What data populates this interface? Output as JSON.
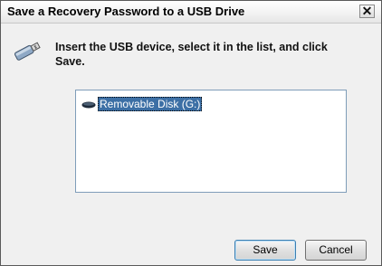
{
  "window": {
    "title": "Save a Recovery Password to a USB Drive",
    "close_label": "✕"
  },
  "icons": {
    "header": "usb-drive-icon",
    "list_item": "removable-disk-icon",
    "close": "close-icon"
  },
  "instruction": "Insert the USB device, select it in the list, and click Save.",
  "device_list": {
    "items": [
      {
        "label": "Removable Disk (G:)",
        "selected": true
      }
    ]
  },
  "buttons": {
    "save": "Save",
    "cancel": "Cancel"
  },
  "colors": {
    "selection": "#3c6fa5",
    "dialog_background": "#f0f0f0"
  }
}
